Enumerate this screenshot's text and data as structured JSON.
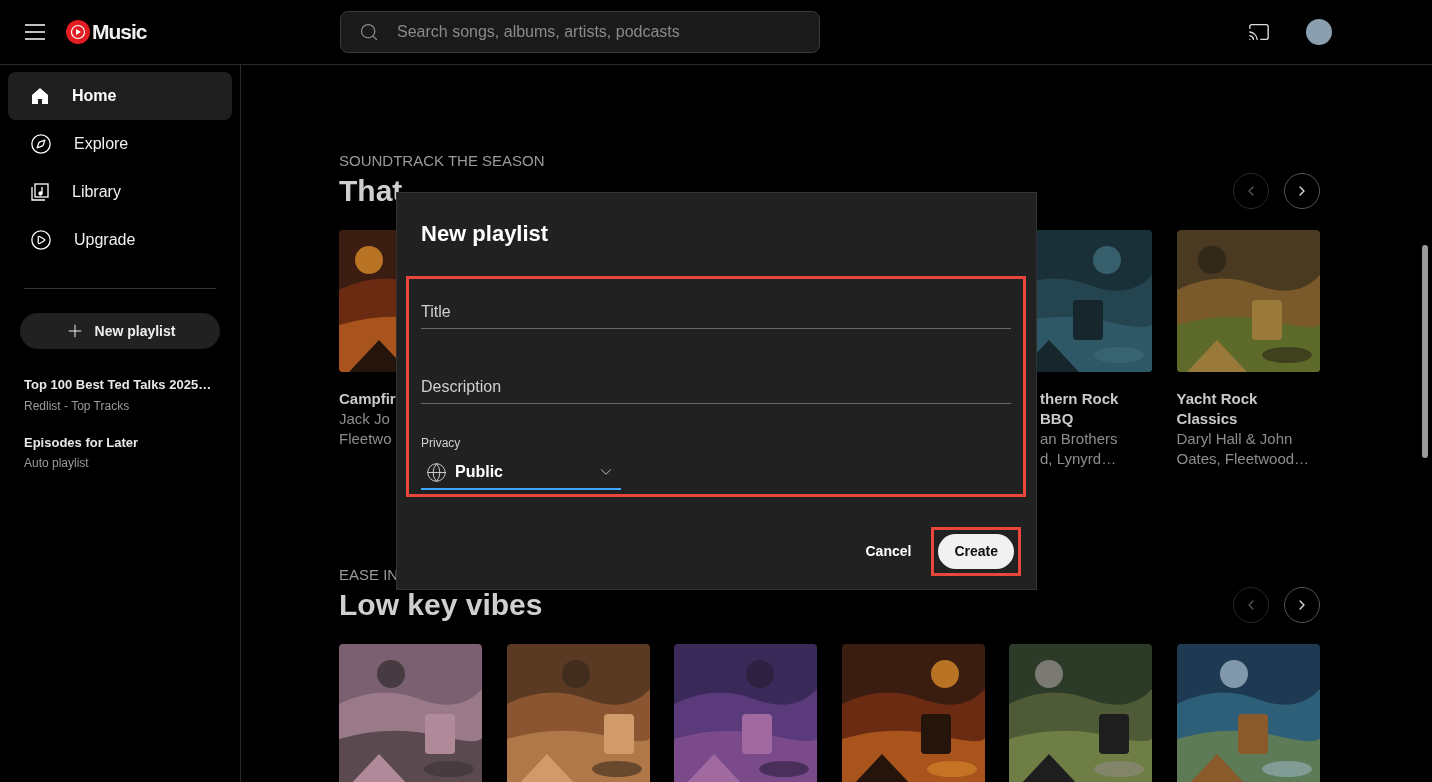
{
  "header": {
    "logo_text": "Music",
    "search": {
      "placeholder": "Search songs, albums, artists, podcasts"
    }
  },
  "sidebar": {
    "items": [
      {
        "label": "Home",
        "selected": true
      },
      {
        "label": "Explore",
        "selected": false
      },
      {
        "label": "Library",
        "selected": false
      },
      {
        "label": "Upgrade",
        "selected": false
      }
    ],
    "new_playlist_button": "New playlist",
    "playlists": [
      {
        "title": "Top 100 Best Ted Talks 2025…",
        "subtitle": "Redlist - Top Tracks"
      },
      {
        "title": "Episodes for Later",
        "subtitle": "Auto playlist"
      }
    ]
  },
  "sections": [
    {
      "label": "SOUNDTRACK THE SEASON",
      "heading": "That",
      "prev_disabled": true,
      "next_disabled": false,
      "cards": [
        {
          "kind": "picture",
          "title": "Campfir",
          "subtitle_lines": [
            "Jack Jo",
            "Fleetwo"
          ]
        },
        {
          "kind": "hidden"
        },
        {
          "kind": "hidden"
        },
        {
          "kind": "hidden"
        },
        {
          "kind": "picture_cut_left",
          "title": "thern Rock BBQ",
          "subtitle_lines": [
            "an Brothers",
            "d, Lynyrd…"
          ]
        },
        {
          "kind": "picture",
          "title": "Yacht Rock Classics",
          "subtitle_lines": [
            "Daryl Hall & John",
            "Oates, Fleetwood…"
          ]
        }
      ]
    },
    {
      "label": "EASE IN",
      "heading": "Low key vibes",
      "prev_disabled": true,
      "next_disabled": false
    }
  ],
  "dialog": {
    "title": "New playlist",
    "form_highlighted": true,
    "fields": [
      {
        "label": "Title"
      },
      {
        "label": "Description"
      }
    ],
    "privacy": {
      "label": "Privacy",
      "value": "Public"
    },
    "cancel": "Cancel",
    "create": "Create",
    "create_highlighted": true
  }
}
